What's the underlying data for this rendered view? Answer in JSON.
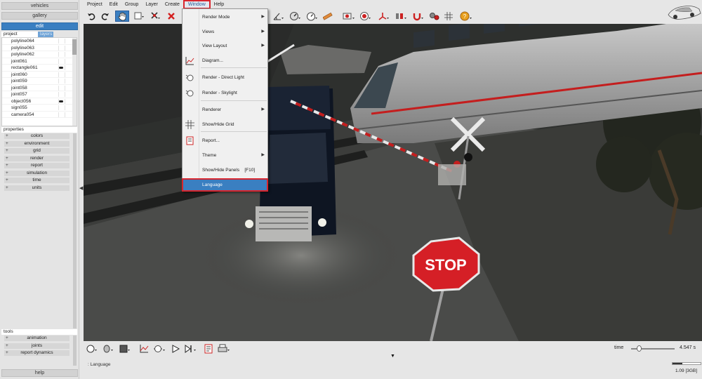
{
  "left_panel": {
    "nav": [
      "vehicles",
      "gallery",
      "edit"
    ],
    "tabs": [
      "project",
      "layers"
    ],
    "project_items": [
      "polyline064",
      "polyline063",
      "polyline062",
      "joint061",
      "rectangle061",
      "joint060",
      "joint059",
      "joint058",
      "joint057",
      "object056",
      "sign055",
      "camera054"
    ],
    "properties_label": "properties",
    "properties_items": [
      "colors",
      "environment",
      "grid",
      "render",
      "report",
      "simulation",
      "time",
      "units"
    ],
    "tools_label": "tools",
    "tools_items": [
      "animation",
      "joints",
      "report dynamics"
    ],
    "help": "help",
    "collapse_arrow": "◀"
  },
  "menubar": {
    "items": [
      "Project",
      "Edit",
      "Group",
      "Layer",
      "Create",
      "Window",
      "Help"
    ],
    "active": "Window"
  },
  "window_menu": {
    "items": [
      {
        "label": "Render Mode",
        "submenu": true
      },
      {
        "label": "Views",
        "submenu": true
      },
      {
        "label": "View Layout",
        "submenu": true
      },
      {
        "label": "Diagram...",
        "submenu": false
      },
      {
        "label": "Render - Direct Light",
        "submenu": false
      },
      {
        "label": "Render - Skylight",
        "submenu": false
      },
      {
        "label": "Renderer",
        "submenu": true
      },
      {
        "label": "Show/Hide Grid",
        "submenu": false
      },
      {
        "label": "Report...",
        "submenu": false
      },
      {
        "label": "Theme",
        "submenu": true
      },
      {
        "label": "Show/Hide Panels    [F10]",
        "submenu": false
      },
      {
        "label": "Language",
        "submenu": false
      }
    ],
    "highlighted": "Language"
  },
  "scene": {
    "sign_text": "STOP"
  },
  "bottom": {
    "time_label": "time",
    "time_value": "4.547 s",
    "time_fraction": 0.17,
    "status_text": ": Language",
    "memory": "1.09 [3GB]",
    "memory_fraction": 0.35,
    "center_arrow": "▼"
  },
  "colors": {
    "accent": "#3a7fc1",
    "highlight_border": "#d9252d"
  }
}
